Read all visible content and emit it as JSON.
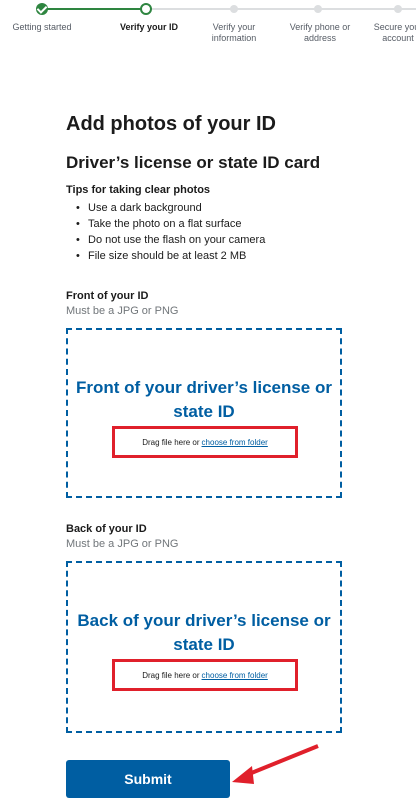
{
  "stepper": {
    "steps": [
      {
        "label": "Getting started",
        "status": "done"
      },
      {
        "label": "Verify your ID",
        "status": "current"
      },
      {
        "label": "Verify your\ninformation",
        "status": "future"
      },
      {
        "label": "Verify phone or\naddress",
        "status": "future"
      },
      {
        "label": "Secure your\naccount",
        "status": "future"
      }
    ]
  },
  "main": {
    "title": "Add photos of your ID",
    "subtitle": "Driver’s license or state ID card",
    "tips_title": "Tips for taking clear photos",
    "tips": [
      "Use a dark background",
      "Take the photo on a flat surface",
      "Do not use the flash on your camera",
      "File size should be at least 2 MB"
    ]
  },
  "front": {
    "label": "Front of your ID",
    "hint": "Must be a JPG or PNG",
    "dropzone_title": "Front of your driver’s license or state ID",
    "drag_text": "Drag file here or",
    "choose_link": "choose from folder"
  },
  "back": {
    "label": "Back of your ID",
    "hint": "Must be a JPG or PNG",
    "dropzone_title": "Back of your driver’s license or state ID",
    "drag_text": "Drag file here or",
    "choose_link": "choose from folder"
  },
  "submit_label": "Submit",
  "colors": {
    "primary": "#005ea2",
    "success": "#2e8540",
    "annotation_red": "#e0202b"
  }
}
